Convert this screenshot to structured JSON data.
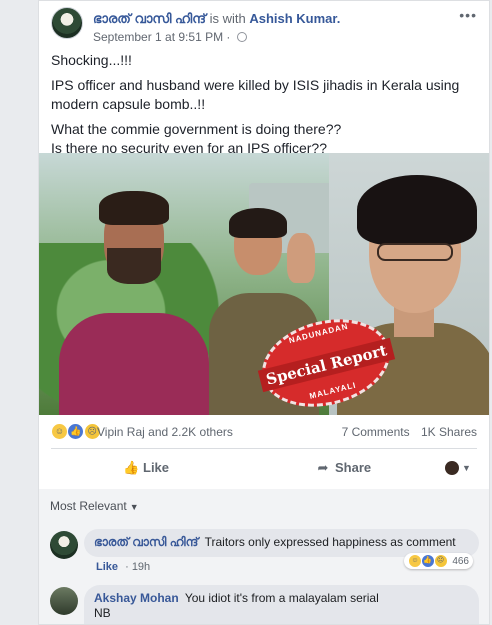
{
  "post": {
    "author": "ഭാരത് വാസി ഹിന്ദ്",
    "with_text": "is with",
    "tagged": "Ashish Kumar.",
    "timestamp": "September 1 at 9:51 PM",
    "audience_icon": "globe-icon",
    "more_label": "•••",
    "text": [
      "Shocking...!!!",
      "IPS officer and husband were killed by ISIS jihadis in Kerala using modern capsule bomb..!!",
      "What the commie government is doing there??\nIs there no security even for an IPS officer??"
    ],
    "image": {
      "stamp_top": "NADUNADAN",
      "stamp_main": "Special Report",
      "stamp_bottom": "MALAYALI"
    }
  },
  "reactions": {
    "icons": [
      "haha-icon",
      "like-icon",
      "sad-icon"
    ],
    "names": "Vipin Raj and 2.2K others",
    "comments": "7 Comments",
    "shares": "1K Shares"
  },
  "actions": {
    "like_label": "Like",
    "share_label": "Share"
  },
  "comments": {
    "sort_label": "Most Relevant",
    "items": [
      {
        "author": "ഭാരത് വാസി ഹിന്ദ്",
        "text": "Traitors only expressed happiness as comment",
        "like_label": "Like",
        "time": "19h",
        "reaction_count": "466"
      },
      {
        "author": "Akshay Mohan",
        "text": "You idiot it's from a malayalam serial",
        "text2": "NB"
      }
    ]
  },
  "colors": {
    "link": "#365899",
    "stamp_red": "#d62b2b",
    "page_bg": "#e9ebee"
  }
}
